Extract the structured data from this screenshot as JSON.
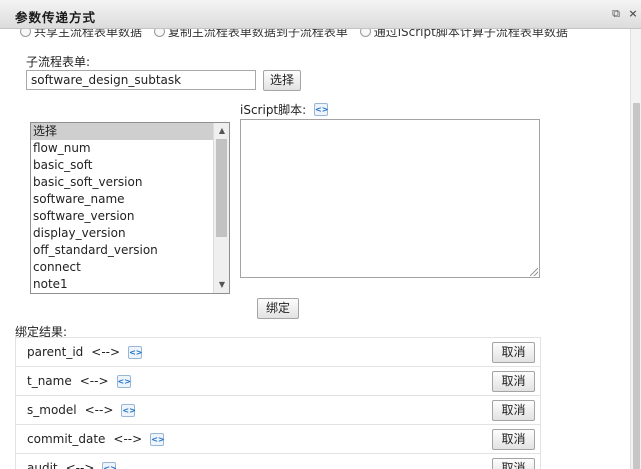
{
  "window": {
    "title": "参数传递方式",
    "maximize_icon": "maximize-icon",
    "close_icon": "close-icon"
  },
  "radio_options": [
    "共享主流程表单数据",
    "复制主流程表单数据到子流程表单",
    "通过iScript脚本计算子流程表单数据"
  ],
  "subform": {
    "label": "子流程表单:",
    "value": "software_design_subtask",
    "select_button": "选择"
  },
  "field_list": {
    "items": [
      "选择",
      "flow_num",
      "basic_soft",
      "basic_soft_version",
      "software_name",
      "software_version",
      "display_version",
      "off_standard_version",
      "connect",
      "note1"
    ],
    "selected": "选择"
  },
  "iscript": {
    "label": "iScript脚本:",
    "insert_icon": "insert-script-icon"
  },
  "bind_button": "绑定",
  "bind_results": {
    "label": "绑定结果:",
    "arrow": "<-->",
    "cancel_label": "取消",
    "rows": [
      {
        "field": "parent_id"
      },
      {
        "field": "t_name"
      },
      {
        "field": "s_model"
      },
      {
        "field": "commit_date"
      },
      {
        "field": "audit"
      }
    ]
  }
}
